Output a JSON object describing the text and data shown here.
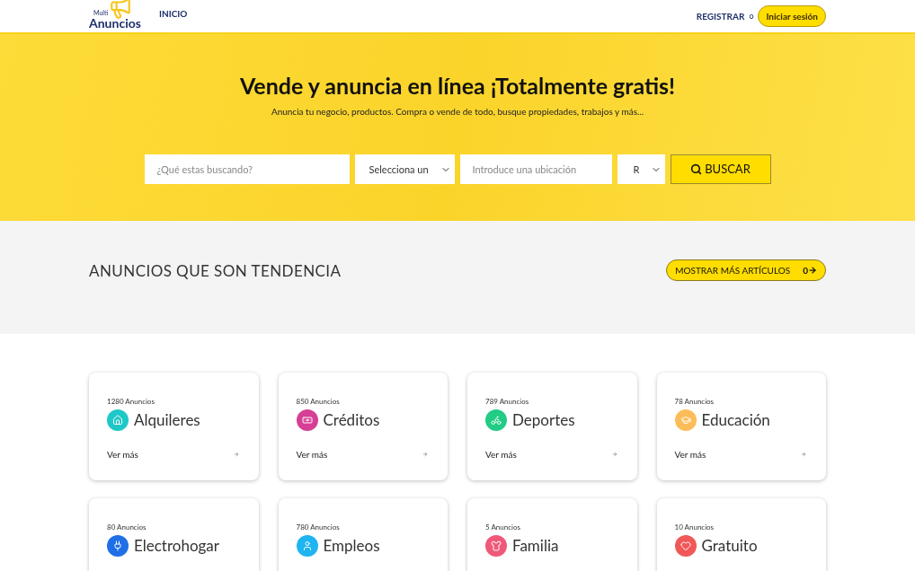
{
  "header": {
    "logo_small": "Multi",
    "logo": "Anuncios",
    "nav": [
      {
        "label": "INICIO"
      }
    ],
    "register": "REGISTRAR",
    "separator": "o",
    "login": "Iniciar sesión"
  },
  "hero": {
    "title": "Vende y anuncia en línea ¡Totalmente gratis!",
    "subtitle": "Anuncia tu negocio, productos. Compra o vende de todo, busque propiedades, trabajos y más...",
    "search": {
      "query_placeholder": "¿Qué estas buscando?",
      "category_value": "Selecciona un",
      "location_placeholder": "Introduce una ubicación",
      "radius_value": "R",
      "button": "BUSCAR"
    }
  },
  "trending": {
    "title": "ANUNCIOS QUE SON TENDENCIA",
    "button": "MOSTRAR MÁS ARTÍCULOS",
    "count": "0"
  },
  "categories": [
    {
      "count": "1280 Anuncios",
      "name": "Alquileres",
      "color": "#1fc7c7",
      "link": "Ver más"
    },
    {
      "count": "850 Anuncios",
      "name": "Créditos",
      "color": "#d63f95",
      "link": "Ver más"
    },
    {
      "count": "789 Anuncios",
      "name": "Deportes",
      "color": "#22cc85",
      "link": "Ver más"
    },
    {
      "count": "78 Anuncios",
      "name": "Educación",
      "color": "#fbbd5a",
      "link": "Ver más"
    },
    {
      "count": "80 Anuncios",
      "name": "Electrohogar",
      "color": "#1f6fe6"
    },
    {
      "count": "780 Anuncios",
      "name": "Empleos",
      "color": "#1eb4f0"
    },
    {
      "count": "5 Anuncios",
      "name": "Familia",
      "color": "#f0587a"
    },
    {
      "count": "10 Anuncios",
      "name": "Gratuito",
      "color": "#f05858"
    }
  ]
}
